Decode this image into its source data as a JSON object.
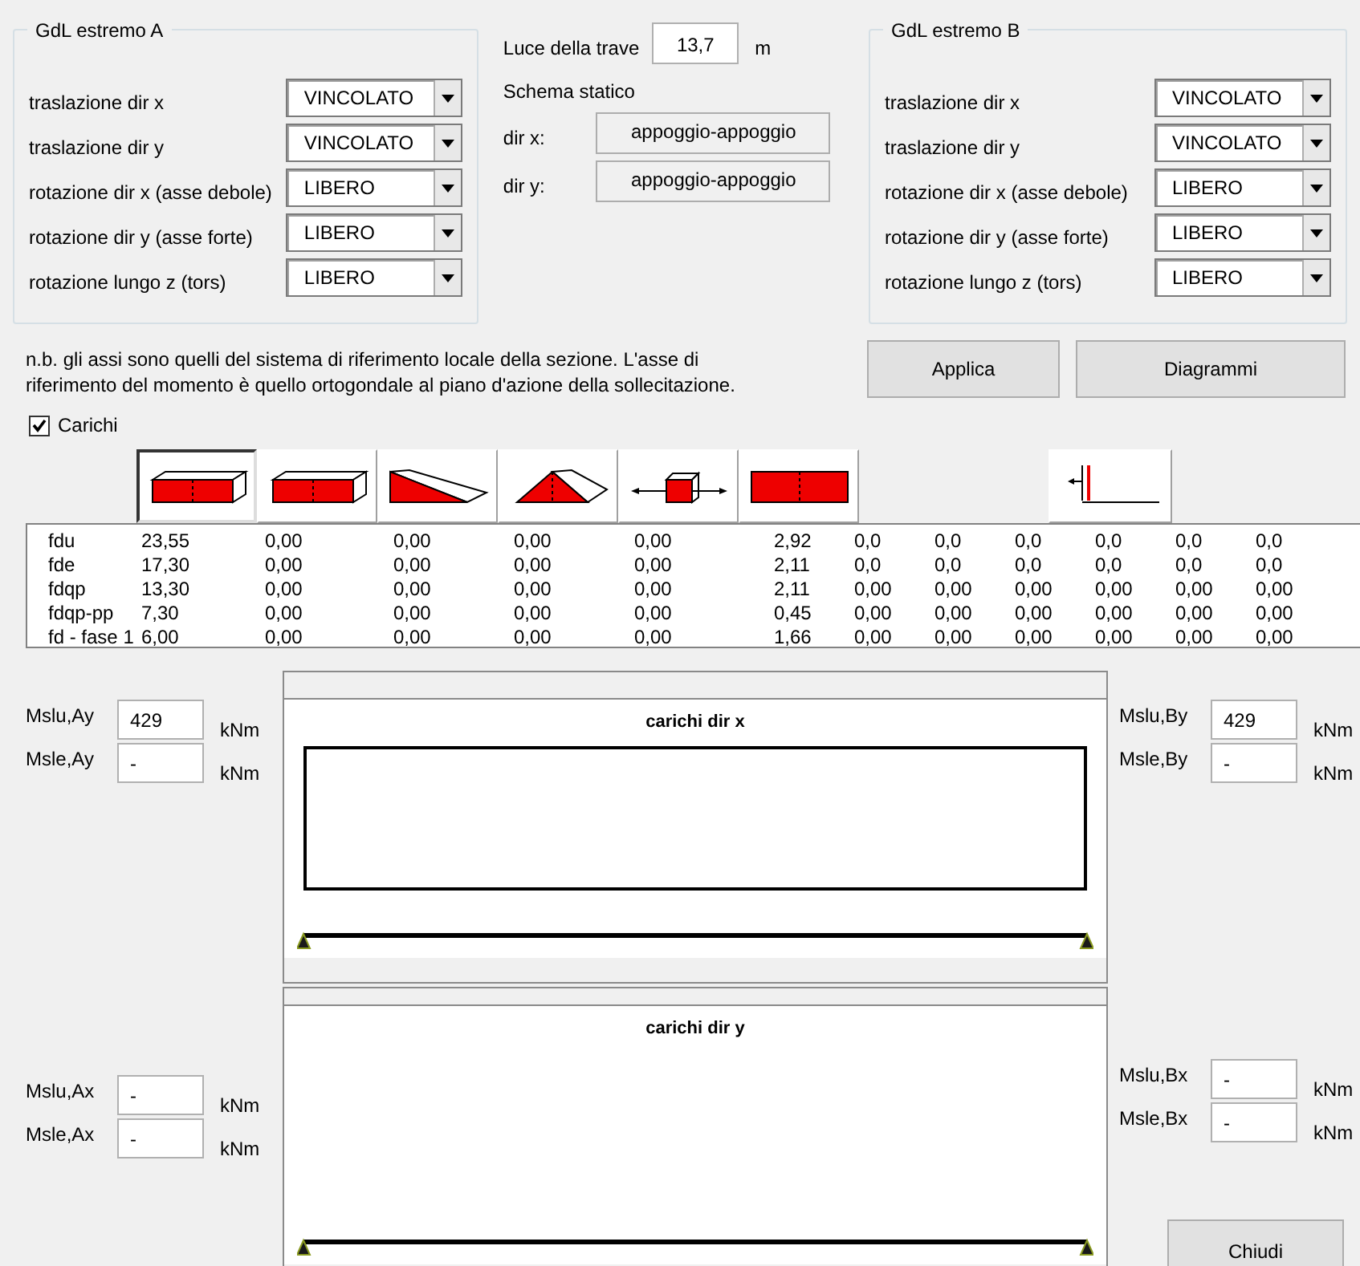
{
  "group_a": {
    "title": "GdL estremo A",
    "rows": [
      {
        "label": "traslazione dir x",
        "value": "VINCOLATO"
      },
      {
        "label": "traslazione dir y",
        "value": "VINCOLATO"
      },
      {
        "label": "rotazione dir x (asse debole)",
        "value": "LIBERO"
      },
      {
        "label": "rotazione dir y (asse forte)",
        "value": "LIBERO"
      },
      {
        "label": "rotazione lungo z (tors)",
        "value": "LIBERO"
      }
    ]
  },
  "span": {
    "label": "Luce della trave",
    "value": "13,7",
    "unit": "m"
  },
  "scheme": {
    "title": "Schema statico",
    "rows": [
      {
        "label": "dir x:",
        "value": "appoggio-appoggio"
      },
      {
        "label": "dir y:",
        "value": "appoggio-appoggio"
      }
    ]
  },
  "group_b": {
    "title": "GdL estremo B",
    "rows": [
      {
        "label": "traslazione dir x",
        "value": "VINCOLATO"
      },
      {
        "label": "traslazione dir y",
        "value": "VINCOLATO"
      },
      {
        "label": "rotazione dir x (asse debole)",
        "value": "LIBERO"
      },
      {
        "label": "rotazione dir y (asse forte)",
        "value": "LIBERO"
      },
      {
        "label": "rotazione lungo z (tors)",
        "value": "LIBERO"
      }
    ]
  },
  "note": [
    "n.b. gli assi sono quelli del sistema di riferimento locale della sezione. L'asse di",
    "riferimento del momento è quello ortogondale al piano d'azione della sollecitazione."
  ],
  "actions": [
    {
      "label": "Applica"
    },
    {
      "label": "Diagrammi"
    }
  ],
  "loads_toggle": {
    "label": "Carichi",
    "checked": true
  },
  "load_types": [
    {
      "kind": "box",
      "selected": true
    },
    {
      "kind": "box",
      "selected": false
    },
    {
      "kind": "wedge",
      "selected": false
    },
    {
      "kind": "triangle",
      "selected": false
    },
    {
      "kind": "axial",
      "selected": false
    },
    {
      "kind": "flat",
      "selected": false
    },
    {
      "kind": "moment",
      "selected": false
    }
  ],
  "table": {
    "rows": [
      {
        "label": "fdu",
        "values": [
          "23,55",
          "0,00",
          "0,00",
          "0,00",
          "0,00",
          "2,92",
          "0,0",
          "0,0",
          "0,0",
          "0,0",
          "0,0",
          "0,0"
        ]
      },
      {
        "label": "fde",
        "values": [
          "17,30",
          "0,00",
          "0,00",
          "0,00",
          "0,00",
          "2,11",
          "0,0",
          "0,0",
          "0,0",
          "0,0",
          "0,0",
          "0,0"
        ]
      },
      {
        "label": "fdqp",
        "values": [
          "13,30",
          "0,00",
          "0,00",
          "0,00",
          "0,00",
          "2,11",
          "0,00",
          "0,00",
          "0,00",
          "0,00",
          "0,00",
          "0,00"
        ]
      },
      {
        "label": "fdqp-pp",
        "values": [
          "7,30",
          "0,00",
          "0,00",
          "0,00",
          "0,00",
          "0,45",
          "0,00",
          "0,00",
          "0,00",
          "0,00",
          "0,00",
          "0,00"
        ]
      },
      {
        "label": "fd - fase 1",
        "values": [
          "6,00",
          "0,00",
          "0,00",
          "0,00",
          "0,00",
          "1,66",
          "0,00",
          "0,00",
          "0,00",
          "0,00",
          "0,00",
          "0,00"
        ]
      }
    ]
  },
  "moments_top": {
    "left": [
      {
        "label": "Mslu,Ay",
        "value": "429",
        "unit": "kNm"
      },
      {
        "label": "Msle,Ay",
        "value": "-",
        "unit": "kNm"
      }
    ],
    "right": [
      {
        "label": "Mslu,By",
        "value": "429",
        "unit": "kNm"
      },
      {
        "label": "Msle,By",
        "value": "-",
        "unit": "kNm"
      }
    ]
  },
  "diagrams": [
    {
      "title": "carichi dir x",
      "load_shown": true
    },
    {
      "title": "carichi dir y",
      "load_shown": false
    }
  ],
  "moments_bottom": {
    "left": [
      {
        "label": "Mslu,Ax",
        "value": "-",
        "unit": "kNm"
      },
      {
        "label": "Msle,Ax",
        "value": "-",
        "unit": "kNm"
      }
    ],
    "right": [
      {
        "label": "Mslu,Bx",
        "value": "-",
        "unit": "kNm"
      },
      {
        "label": "Msle,Bx",
        "value": "-",
        "unit": "kNm"
      }
    ]
  },
  "close_button": "Chiudi"
}
